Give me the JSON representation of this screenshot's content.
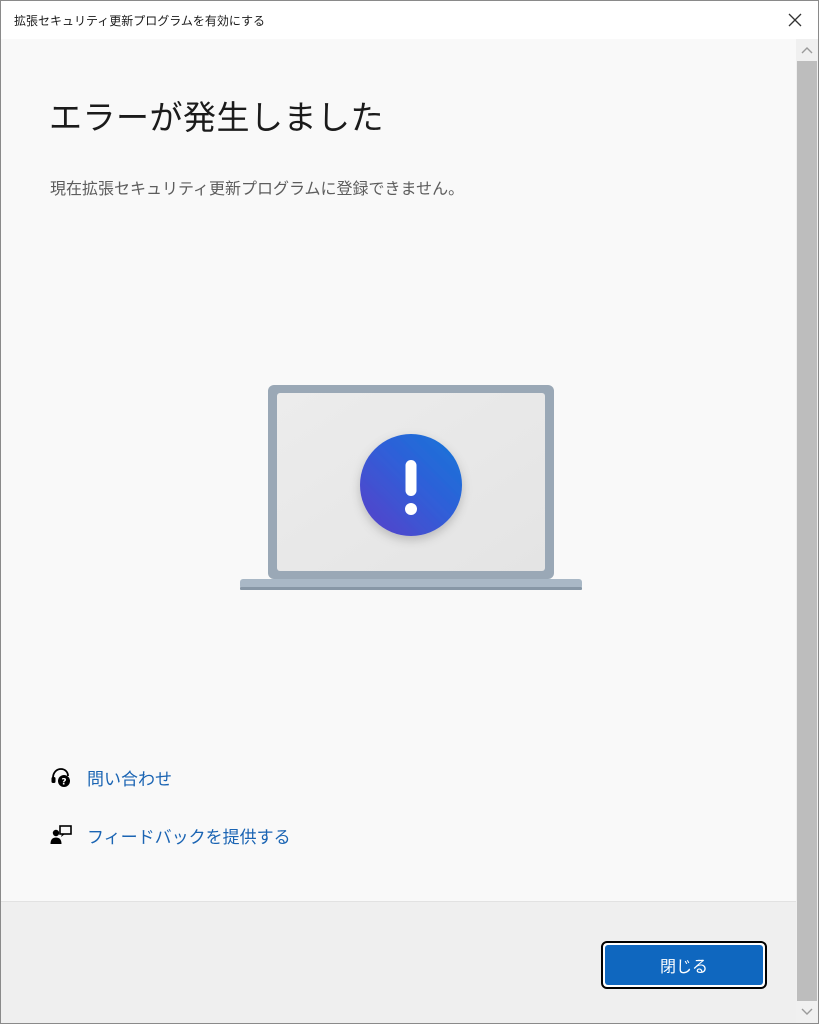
{
  "window": {
    "title": "拡張セキュリティ更新プログラムを有効にする",
    "close_icon": "close-icon"
  },
  "main": {
    "heading": "エラーが発生しました",
    "message": "現在拡張セキュリティ更新プログラムに登録できません。",
    "illustration": "laptop-error-illustration",
    "accent_color": "#0f67bf"
  },
  "links": [
    {
      "label": "問い合わせ",
      "icon": "contact-support-icon"
    },
    {
      "label": "フィードバックを提供する",
      "icon": "feedback-icon"
    }
  ],
  "footer": {
    "close_button_label": "閉じる"
  },
  "colors": {
    "link": "#1a64b3",
    "button": "#0f67bf",
    "background": "#f9f9f9"
  }
}
